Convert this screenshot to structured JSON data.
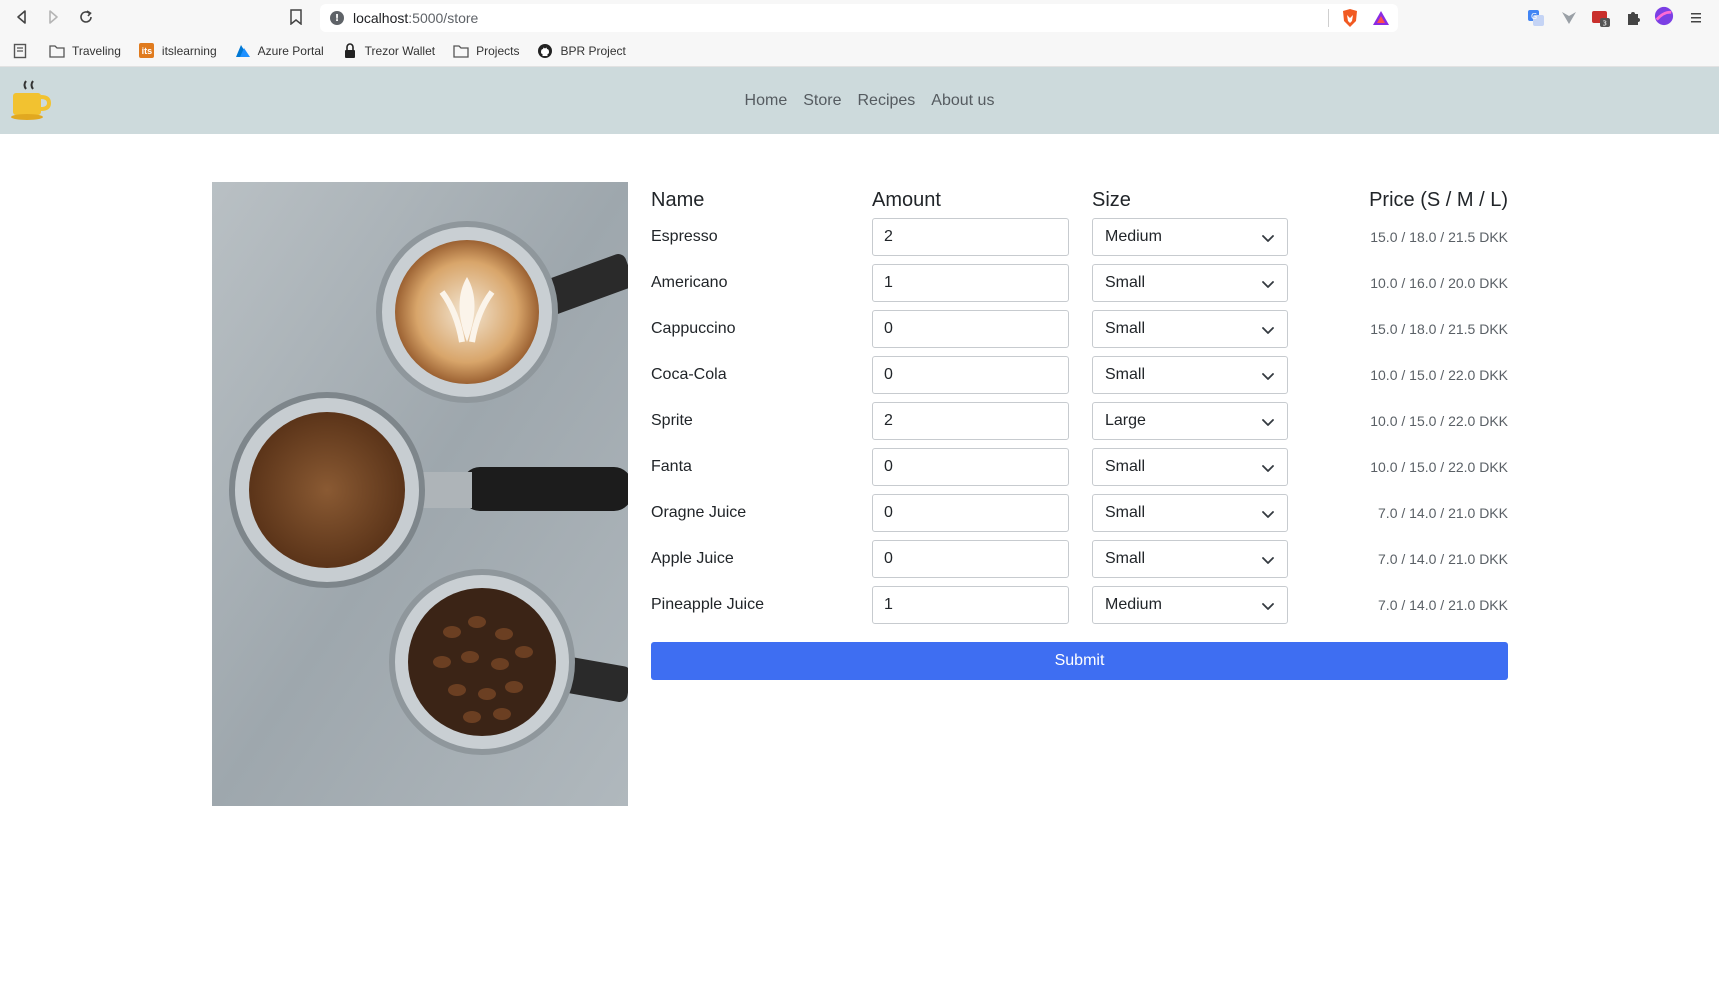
{
  "browser": {
    "url_host": "localhost",
    "url_path": ":5000/store",
    "bookmarks": [
      {
        "label": "Traveling",
        "icon": "folder-icon"
      },
      {
        "label": "itslearning",
        "icon": "itslearning-icon",
        "icon_text": "its"
      },
      {
        "label": "Azure Portal",
        "icon": "azure-icon"
      },
      {
        "label": "Trezor Wallet",
        "icon": "lock-icon"
      },
      {
        "label": "Projects",
        "icon": "folder-icon"
      },
      {
        "label": "BPR Project",
        "icon": "github-icon"
      }
    ],
    "extension_badge": "3"
  },
  "navbar": {
    "links": [
      "Home",
      "Store",
      "Recipes",
      "About us"
    ]
  },
  "table": {
    "headers": {
      "name": "Name",
      "amount": "Amount",
      "size": "Size",
      "price": "Price (S / M / L)"
    },
    "rows": [
      {
        "name": "Espresso",
        "amount": "2",
        "size": "Medium",
        "price": "15.0 / 18.0 / 21.5 DKK"
      },
      {
        "name": "Americano",
        "amount": "1",
        "size": "Small",
        "price": "10.0 / 16.0 / 20.0 DKK"
      },
      {
        "name": "Cappuccino",
        "amount": "0",
        "size": "Small",
        "price": "15.0 / 18.0 / 21.5 DKK"
      },
      {
        "name": "Coca-Cola",
        "amount": "0",
        "size": "Small",
        "price": "10.0 / 15.0 / 22.0 DKK"
      },
      {
        "name": "Sprite",
        "amount": "2",
        "size": "Large",
        "price": "10.0 / 15.0 / 22.0 DKK"
      },
      {
        "name": "Fanta",
        "amount": "0",
        "size": "Small",
        "price": "10.0 / 15.0 / 22.0 DKK"
      },
      {
        "name": "Oragne Juice",
        "amount": "0",
        "size": "Small",
        "price": "7.0 / 14.0 / 21.0 DKK"
      },
      {
        "name": "Apple Juice",
        "amount": "0",
        "size": "Small",
        "price": "7.0 / 14.0 / 21.0 DKK"
      },
      {
        "name": "Pineapple Juice",
        "amount": "1",
        "size": "Medium",
        "price": "7.0 / 14.0 / 21.0 DKK"
      }
    ],
    "submit_label": "Submit"
  },
  "colors": {
    "navbar_bg": "#cddadc",
    "submit_bg": "#3e6ef2"
  }
}
